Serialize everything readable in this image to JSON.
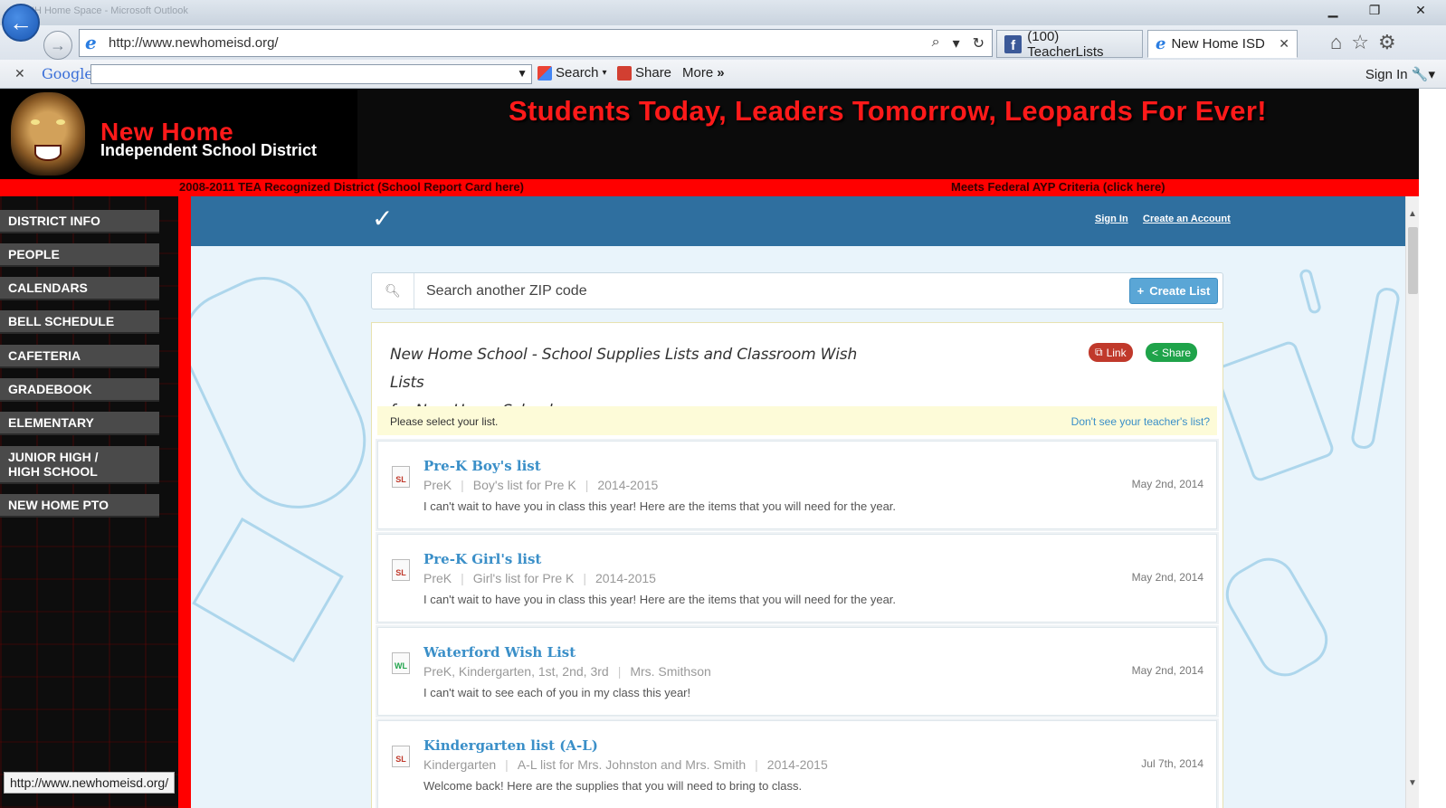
{
  "browser": {
    "window_ghost_title": "NH Home Space - Microsoft Outlook",
    "url": "http://www.newhomeisd.org/",
    "tabs": [
      {
        "label": "(100) TeacherLists"
      },
      {
        "label": "New Home ISD"
      }
    ],
    "google_bar": {
      "logo": "Google",
      "search_label": "Search",
      "share_label": "Share",
      "more_label": "More",
      "more_chevron": "»",
      "sign_in_label": "Sign In"
    },
    "status_url": "http://www.newhomeisd.org/"
  },
  "site": {
    "title": "New Home",
    "subtitle": "Independent School District",
    "slogan": "Students Today, Leaders Tomorrow, Leopards For Ever!",
    "strip_left": "2008-2011 TEA Recognized District (School Report Card here)",
    "strip_right": "Meets Federal AYP Criteria (click here)"
  },
  "nav": {
    "items": [
      {
        "label": "DISTRICT INFO"
      },
      {
        "label": "PEOPLE"
      },
      {
        "label": "CALENDARS"
      },
      {
        "label": "BELL SCHEDULE"
      },
      {
        "label": "CAFETERIA"
      },
      {
        "label": "GRADEBOOK"
      },
      {
        "label": "ELEMENTARY"
      },
      {
        "label": "JUNIOR HIGH /",
        "label2": "HIGH SCHOOL"
      },
      {
        "label": "NEW HOME PTO"
      }
    ]
  },
  "embed": {
    "sign_in": "Sign In",
    "create_account": "Create an Account",
    "search_placeholder": "Search another ZIP code",
    "create_list": "Create List",
    "panel_title_line1": "New Home School - School Supplies Lists and Classroom Wish Lists",
    "panel_title_line2": "for New Home School",
    "link_label": "Link",
    "share_label": "Share",
    "select_prompt": "Please select your list.",
    "dont_see": "Don't see your teacher's list?",
    "lists": [
      {
        "badge": "SL",
        "title": "Pre-K Boy's list",
        "grade": "PreK",
        "detail": "Boy's list for Pre K",
        "year": "2014-2015",
        "desc": "I can't wait to have you in class this year! Here are the items that you will need for the year.",
        "date": "May 2nd, 2014"
      },
      {
        "badge": "SL",
        "title": "Pre-K Girl's list",
        "grade": "PreK",
        "detail": "Girl's list for Pre K",
        "year": "2014-2015",
        "desc": "I can't wait to have you in class this year! Here are the items that you will need for the year.",
        "date": "May 2nd, 2014"
      },
      {
        "badge": "WL",
        "title": "Waterford Wish List",
        "grade": "PreK, Kindergarten, 1st, 2nd, 3rd",
        "detail": "Mrs. Smithson",
        "year": "",
        "desc": "I can't wait to see each of you in my class this year!",
        "date": "May 2nd, 2014"
      },
      {
        "badge": "SL",
        "title": "Kindergarten list (A-L)",
        "grade": "Kindergarten",
        "detail": "A-L list for Mrs. Johnston and Mrs. Smith",
        "year": "2014-2015",
        "desc": "Welcome back! Here are the supplies that you will need to bring to class.",
        "date": "Jul 7th, 2014"
      }
    ]
  },
  "colors": {
    "site_red": "#ff0000",
    "embed_header": "#2f6f9f",
    "link_blue": "#3a8fc8",
    "sl_badge": "#c0392b",
    "wl_badge": "#1fa34a"
  }
}
